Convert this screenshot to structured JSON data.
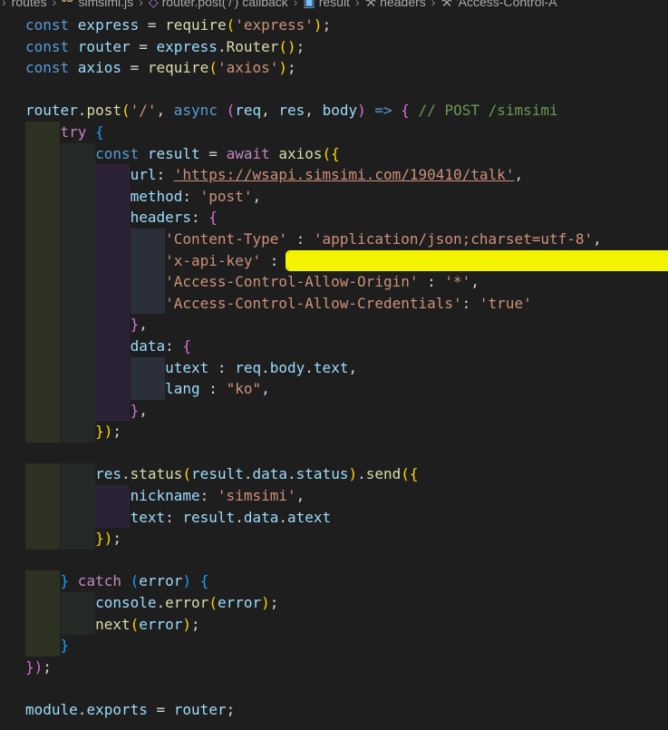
{
  "breadcrumb": {
    "items": [
      {
        "label": "routes",
        "icon": "none"
      },
      {
        "label": "simsimi.js",
        "icon": "js-file-icon"
      },
      {
        "label": "router.post('/') callback",
        "icon": "method-icon"
      },
      {
        "label": "result",
        "icon": "variable-icon"
      },
      {
        "label": "headers",
        "icon": "wrench-icon"
      },
      {
        "label": "'Access-Control-A",
        "icon": "wrench-icon"
      }
    ]
  },
  "code": {
    "lines": [
      [
        [
          "kw",
          "const "
        ],
        [
          "var",
          "express"
        ],
        [
          "pun",
          " = "
        ],
        [
          "fn",
          "require"
        ],
        [
          "b1",
          "("
        ],
        [
          "str",
          "'express'"
        ],
        [
          "b1",
          ")"
        ],
        [
          "pun",
          ";"
        ]
      ],
      [
        [
          "kw",
          "const "
        ],
        [
          "var",
          "router"
        ],
        [
          "pun",
          " = "
        ],
        [
          "var",
          "express"
        ],
        [
          "pun",
          "."
        ],
        [
          "fn",
          "Router"
        ],
        [
          "b1",
          "()"
        ],
        [
          "pun",
          ";"
        ]
      ],
      [
        [
          "kw",
          "const "
        ],
        [
          "var",
          "axios"
        ],
        [
          "pun",
          " = "
        ],
        [
          "fn",
          "require"
        ],
        [
          "b1",
          "("
        ],
        [
          "str",
          "'axios'"
        ],
        [
          "b1",
          ")"
        ],
        [
          "pun",
          ";"
        ]
      ],
      [],
      [
        [
          "var",
          "router"
        ],
        [
          "pun",
          "."
        ],
        [
          "fn",
          "post"
        ],
        [
          "b1",
          "("
        ],
        [
          "str",
          "'/'"
        ],
        [
          "pun",
          ", "
        ],
        [
          "kw",
          "async "
        ],
        [
          "b2",
          "("
        ],
        [
          "var",
          "req"
        ],
        [
          "pun",
          ", "
        ],
        [
          "var",
          "res"
        ],
        [
          "pun",
          ", "
        ],
        [
          "var",
          "body"
        ],
        [
          "b2",
          ")"
        ],
        [
          "kw",
          " => "
        ],
        [
          "b2",
          "{"
        ],
        [
          "com",
          " // POST /simsimi"
        ]
      ],
      [
        [
          "pun",
          "    "
        ],
        [
          "ctl",
          "try "
        ],
        [
          "b3",
          "{"
        ]
      ],
      [
        [
          "pun",
          "        "
        ],
        [
          "kw",
          "const "
        ],
        [
          "var",
          "result"
        ],
        [
          "pun",
          " = "
        ],
        [
          "ctl",
          "await "
        ],
        [
          "fn",
          "axios"
        ],
        [
          "b1",
          "({"
        ]
      ],
      [
        [
          "pun",
          "            "
        ],
        [
          "var",
          "url"
        ],
        [
          "pun",
          ": "
        ],
        [
          "url",
          "'https://wsapi.simsimi.com/190410/talk'"
        ],
        [
          "pun",
          ","
        ]
      ],
      [
        [
          "pun",
          "            "
        ],
        [
          "var",
          "method"
        ],
        [
          "pun",
          ": "
        ],
        [
          "str",
          "'post'"
        ],
        [
          "pun",
          ","
        ]
      ],
      [
        [
          "pun",
          "            "
        ],
        [
          "var",
          "headers"
        ],
        [
          "pun",
          ": "
        ],
        [
          "b2",
          "{"
        ]
      ],
      [
        [
          "pun",
          "                "
        ],
        [
          "str",
          "'Content-Type'"
        ],
        [
          "pun",
          " : "
        ],
        [
          "str",
          "'application/json;charset=utf-8'"
        ],
        [
          "pun",
          ","
        ]
      ],
      [
        [
          "pun",
          "                "
        ],
        [
          "str",
          "'x-api-key'"
        ],
        [
          "pun",
          " : "
        ],
        [
          "mark",
          "'K■■■■■■■■■■■■■■■■■■■■■■■■■■■■■■■■■■■■■■■■■'"
        ],
        [
          "pun",
          ","
        ]
      ],
      [
        [
          "pun",
          "                "
        ],
        [
          "str",
          "'Access-Control-Allow-Origin'"
        ],
        [
          "pun",
          " : "
        ],
        [
          "str",
          "'*'"
        ],
        [
          "pun",
          ","
        ]
      ],
      [
        [
          "pun",
          "                "
        ],
        [
          "str",
          "'Access-Control-Allow-Credentials'"
        ],
        [
          "pun",
          ": "
        ],
        [
          "str",
          "'true'"
        ]
      ],
      [
        [
          "pun",
          "            "
        ],
        [
          "b2",
          "}"
        ],
        [
          "pun",
          ","
        ]
      ],
      [
        [
          "pun",
          "            "
        ],
        [
          "var",
          "data"
        ],
        [
          "pun",
          ": "
        ],
        [
          "b2",
          "{"
        ]
      ],
      [
        [
          "pun",
          "                "
        ],
        [
          "var",
          "utext"
        ],
        [
          "pun",
          " : "
        ],
        [
          "var",
          "req"
        ],
        [
          "pun",
          "."
        ],
        [
          "var",
          "body"
        ],
        [
          "pun",
          "."
        ],
        [
          "var",
          "text"
        ],
        [
          "pun",
          ","
        ]
      ],
      [
        [
          "pun",
          "                "
        ],
        [
          "var",
          "lang"
        ],
        [
          "pun",
          " : "
        ],
        [
          "str",
          "\"ko\""
        ],
        [
          "pun",
          ","
        ]
      ],
      [
        [
          "pun",
          "            "
        ],
        [
          "b2",
          "}"
        ],
        [
          "pun",
          ","
        ]
      ],
      [
        [
          "pun",
          "        "
        ],
        [
          "b1",
          "})"
        ],
        [
          "pun",
          ";"
        ]
      ],
      [],
      [
        [
          "pun",
          "        "
        ],
        [
          "var",
          "res"
        ],
        [
          "pun",
          "."
        ],
        [
          "fn",
          "status"
        ],
        [
          "b1",
          "("
        ],
        [
          "var",
          "result"
        ],
        [
          "pun",
          "."
        ],
        [
          "var",
          "data"
        ],
        [
          "pun",
          "."
        ],
        [
          "var",
          "status"
        ],
        [
          "b1",
          ")"
        ],
        [
          "pun",
          "."
        ],
        [
          "fn",
          "send"
        ],
        [
          "b1",
          "({"
        ]
      ],
      [
        [
          "pun",
          "            "
        ],
        [
          "var",
          "nickname"
        ],
        [
          "pun",
          ": "
        ],
        [
          "str",
          "'simsimi'"
        ],
        [
          "pun",
          ","
        ]
      ],
      [
        [
          "pun",
          "            "
        ],
        [
          "var",
          "text"
        ],
        [
          "pun",
          ": "
        ],
        [
          "var",
          "result"
        ],
        [
          "pun",
          "."
        ],
        [
          "var",
          "data"
        ],
        [
          "pun",
          "."
        ],
        [
          "var",
          "atext"
        ]
      ],
      [
        [
          "pun",
          "        "
        ],
        [
          "b1",
          "})"
        ],
        [
          "pun",
          ";"
        ]
      ],
      [],
      [
        [
          "pun",
          "    "
        ],
        [
          "b3",
          "}"
        ],
        [
          "ctl",
          " catch "
        ],
        [
          "b3",
          "("
        ],
        [
          "var",
          "error"
        ],
        [
          "b3",
          ")"
        ],
        [
          "pun",
          " "
        ],
        [
          "b3",
          "{"
        ]
      ],
      [
        [
          "pun",
          "        "
        ],
        [
          "var",
          "console"
        ],
        [
          "pun",
          "."
        ],
        [
          "fn",
          "error"
        ],
        [
          "b1",
          "("
        ],
        [
          "var",
          "error"
        ],
        [
          "b1",
          ")"
        ],
        [
          "pun",
          ";"
        ]
      ],
      [
        [
          "pun",
          "        "
        ],
        [
          "fn",
          "next"
        ],
        [
          "b1",
          "("
        ],
        [
          "var",
          "error"
        ],
        [
          "b1",
          ")"
        ],
        [
          "pun",
          ";"
        ]
      ],
      [
        [
          "pun",
          "    "
        ],
        [
          "b3",
          "}"
        ]
      ],
      [
        [
          "b2",
          "})"
        ],
        [
          "pun",
          ";"
        ]
      ],
      [],
      [
        [
          "var",
          "module"
        ],
        [
          "pun",
          "."
        ],
        [
          "var",
          "exports"
        ],
        [
          "pun",
          " = "
        ],
        [
          "var",
          "router"
        ],
        [
          "pun",
          ";"
        ]
      ]
    ]
  },
  "colors": {
    "background": "#1e1e1e",
    "keyword": "#569cd6",
    "control": "#c586c0",
    "variable": "#9cdcfe",
    "function": "#dcdcaa",
    "string": "#ce9178",
    "comment": "#6a9955",
    "redaction_highlight": "#f4f400"
  }
}
